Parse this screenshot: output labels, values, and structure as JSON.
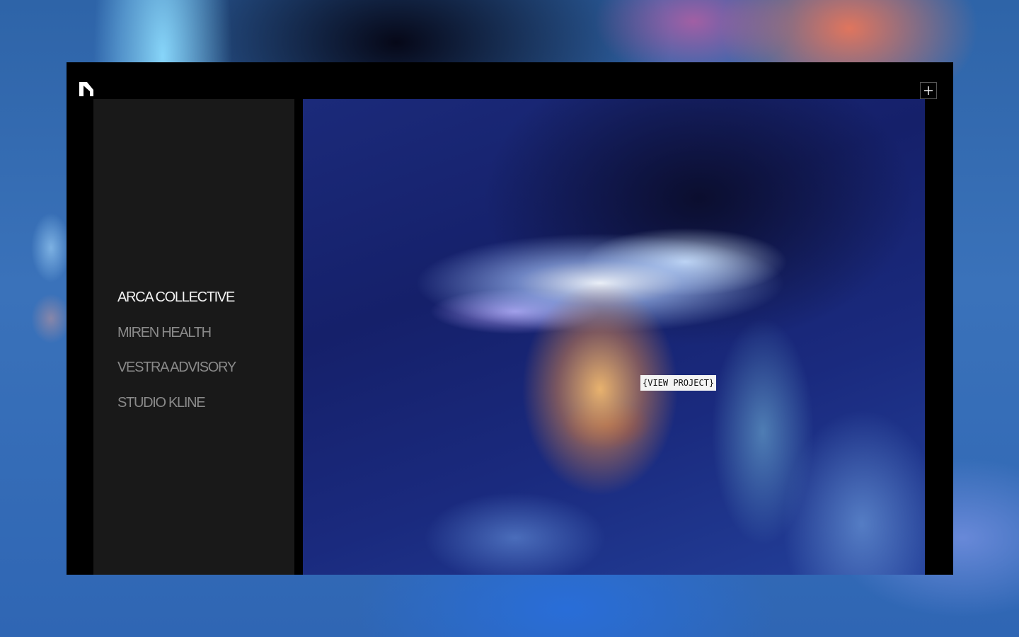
{
  "header": {
    "logo_icon": "monogram-n-icon",
    "menu_icon": "plus-icon"
  },
  "projects": [
    {
      "label": "ARCA COLLECTIVE",
      "active": true
    },
    {
      "label": "MIREN HEALTH",
      "active": false
    },
    {
      "label": "VESTRA ADVISORY",
      "active": false
    },
    {
      "label": "STUDIO KLINE",
      "active": false
    }
  ],
  "preview": {
    "cta_label": "{VIEW PROJECT}"
  },
  "colors": {
    "frame": "#000000",
    "sidebar": "#191919",
    "active_text": "#f2f2f2",
    "inactive_text": "#8a8a8a",
    "tag_bg": "#f4f4f4"
  }
}
